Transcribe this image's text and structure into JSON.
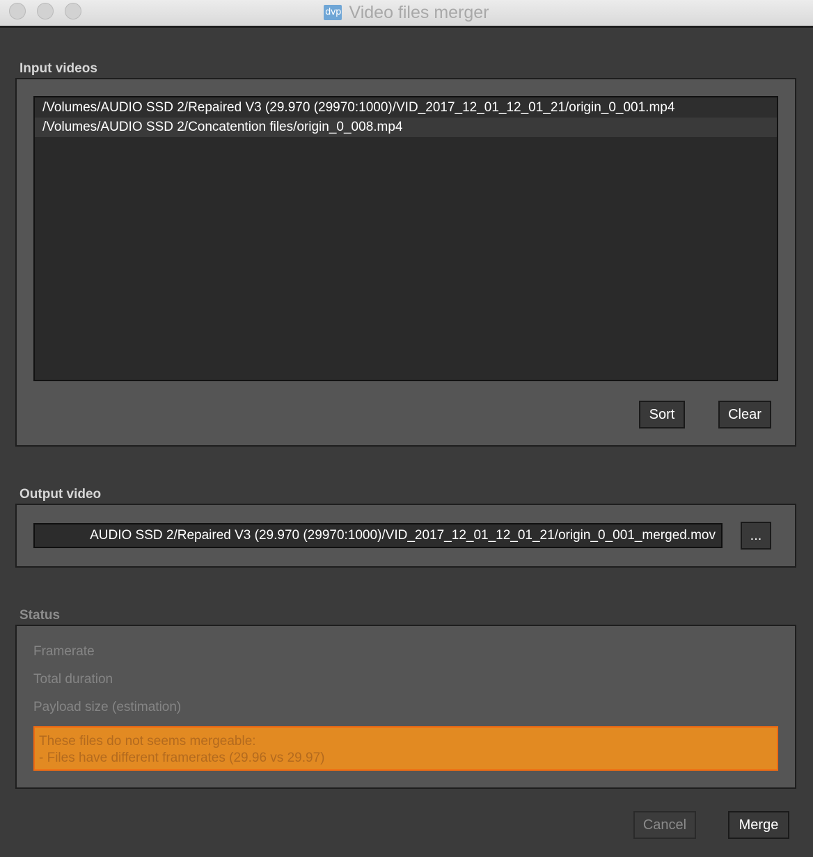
{
  "window": {
    "title": "Video files merger",
    "app_icon_text": "dvp"
  },
  "input_videos": {
    "label": "Input videos",
    "files": [
      "/Volumes/AUDIO SSD 2/Repaired V3 (29.970 (29970:1000)/VID_2017_12_01_12_01_21/origin_0_001.mp4",
      "/Volumes/AUDIO SSD 2/Concatention files/origin_0_008.mp4"
    ],
    "sort_label": "Sort",
    "clear_label": "Clear"
  },
  "output_video": {
    "label": "Output video",
    "path": "AUDIO SSD 2/Repaired V3 (29.970 (29970:1000)/VID_2017_12_01_12_01_21/origin_0_001_merged.mov",
    "browse_label": "..."
  },
  "status": {
    "label": "Status",
    "framerate_label": "Framerate",
    "duration_label": "Total duration",
    "payload_label": "Payload size (estimation)",
    "warning_line1": "These files do not seems mergeable:",
    "warning_line2": "- Files have different framerates (29.96 vs 29.97)"
  },
  "footer": {
    "cancel_label": "Cancel",
    "merge_label": "Merge"
  },
  "colors": {
    "background": "#3b3b3b",
    "panel": "#555555",
    "list_bg": "#2a2a2a",
    "warning_bg": "#e28a22"
  }
}
